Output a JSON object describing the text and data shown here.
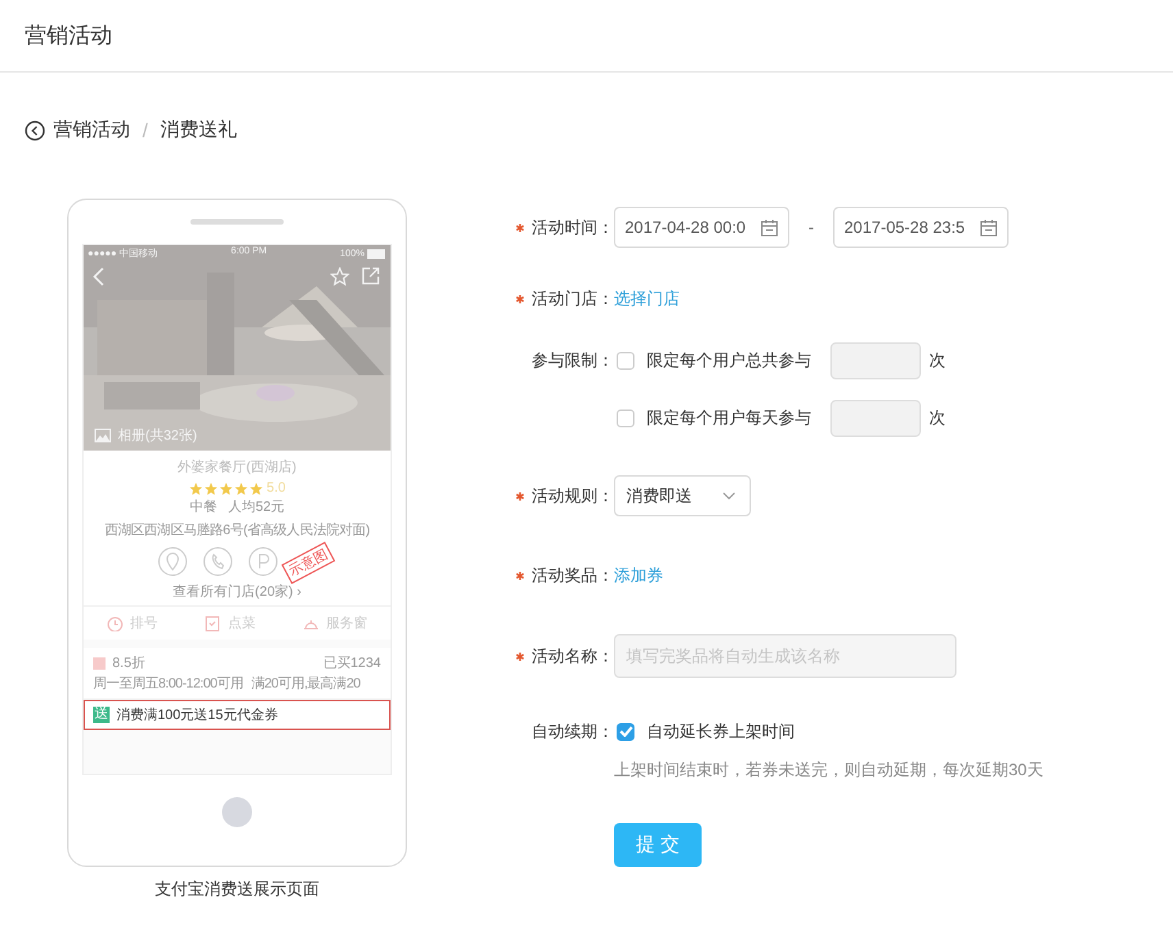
{
  "header": {
    "title": "营销活动"
  },
  "breadcrumb": {
    "items": [
      {
        "label": "营销活动",
        "kind": "link"
      },
      {
        "label": "/",
        "kind": "separator"
      },
      {
        "label": "消费送礼",
        "kind": "current"
      }
    ]
  },
  "preview": {
    "status_bar": {
      "carrier": "●●●●● 中国移动",
      "time": "6:00 PM",
      "battery": "100%"
    },
    "album": "相册(共32张)",
    "store": {
      "name": "外婆家餐厅(西湖店)",
      "stars": 5,
      "rating": "5.0",
      "category": "中餐",
      "avg_price": "人均52元",
      "address": "西湖区西湖区马塍路6号(省高级人民法院对面)",
      "stamp": "示意图",
      "all_stores": "查看所有门店(20家) ›"
    },
    "actions": [
      {
        "kind": "clock",
        "label": "排号"
      },
      {
        "kind": "order",
        "label": "点菜"
      },
      {
        "kind": "service",
        "label": "服务窗"
      }
    ],
    "coupons": [
      {
        "kind": "discount",
        "title": "8.5折",
        "sold": "已买1234",
        "terms": [
          "周一至周五8:00-12:00可用",
          "满20可用,最高满20"
        ],
        "selected": false
      },
      {
        "kind": "gift",
        "badge": "送",
        "title": "消费满100元送15元代金券",
        "selected": true
      }
    ],
    "caption": "支付宝消费送展示页面"
  },
  "form": {
    "fields": [
      {
        "kind": "daterange",
        "label": "活动时间：",
        "required": true,
        "start": "2017-04-28 00:0",
        "separator": "-",
        "end": "2017-05-28 23:5"
      },
      {
        "kind": "link",
        "label": "活动门店：",
        "required": true,
        "text": "选择门店"
      },
      {
        "kind": "limits",
        "label": "参与限制：",
        "required": false,
        "options": [
          {
            "text": "限定每个用户总共参与",
            "checked": false,
            "unit": "次"
          },
          {
            "text": "限定每个用户每天参与",
            "checked": false,
            "unit": "次"
          }
        ]
      },
      {
        "kind": "select",
        "label": "活动规则：",
        "required": true,
        "value": "消费即送"
      },
      {
        "kind": "link",
        "label": "活动奖品：",
        "required": true,
        "text": "添加券"
      },
      {
        "kind": "input",
        "label": "活动名称：",
        "required": true,
        "placeholder": "填写完奖品将自动生成该名称"
      },
      {
        "kind": "checkbox",
        "label": "自动续期：",
        "required": false,
        "text": "自动延长券上架时间",
        "checked": true,
        "hint": "上架时间结束时，若券未送完，则自动延期，每次延期30天"
      }
    ],
    "submit": "提 交"
  }
}
